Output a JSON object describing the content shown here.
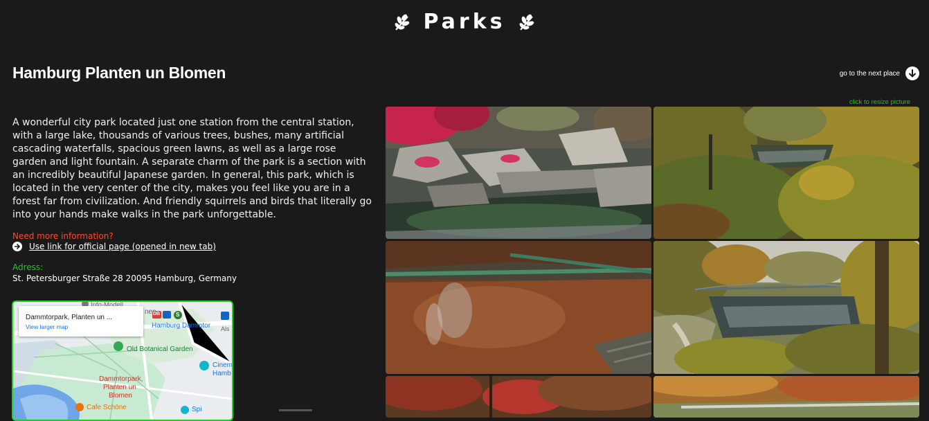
{
  "header": {
    "title": "Parks",
    "leaf_icon": "leaf-icon"
  },
  "place": {
    "name": "Hamburg Planten un Blomen",
    "description": "A wonderful city park located just one station from the central station, with a large lake, thousands of various trees, bushes, many artificial cascading waterfalls, spacious green lawns, as well as a large rose garden and light fountain. A separate charm of the park is a section with an incredibly beautiful Japanese garden. In general, this park, which is located in the very center of the city, makes you feel like you are in a forest far from civilization. And friendly squirrels and birds that literally go into your hands make walks in the park unforgettable.",
    "info_label": "Need more information?",
    "info_link": "Use link for official page (opened in new tab)",
    "address_label": "Adress:",
    "address": "St. Petersburger Straße 28 20095 Hamburg, Germany"
  },
  "nav": {
    "next_label": "go to the next place",
    "resize_hint": "click to resize picture"
  },
  "map": {
    "place_title": "Dammtorpark, Planten un ...",
    "larger_map": "View larger map",
    "labels": {
      "info_model": "Info-Modell",
      "nen": "nen",
      "db": "DB",
      "s": "S",
      "station": "Hamburg Dammtor",
      "als": "Als",
      "garden": "Old Botanical Garden",
      "park1": "Dammtorpark,",
      "park2": "Planten un",
      "park3": "Blomen",
      "cinema1": "Cinem",
      "cinema2": "Hamb",
      "cafe": "Cafe Schöne",
      "spi": "Spi"
    }
  },
  "colors": {
    "accent_green": "#1ec81e",
    "accent_red": "#ff4b2b",
    "background": "#1b1a1b"
  },
  "photos": [
    {
      "name": "japanese-garden-photo"
    },
    {
      "name": "autumn-lake-photo"
    },
    {
      "name": "leaf-pool-photo"
    },
    {
      "name": "lake-bridge-photo"
    },
    {
      "name": "red-trees-photo"
    },
    {
      "name": "autumn-path-photo"
    }
  ]
}
